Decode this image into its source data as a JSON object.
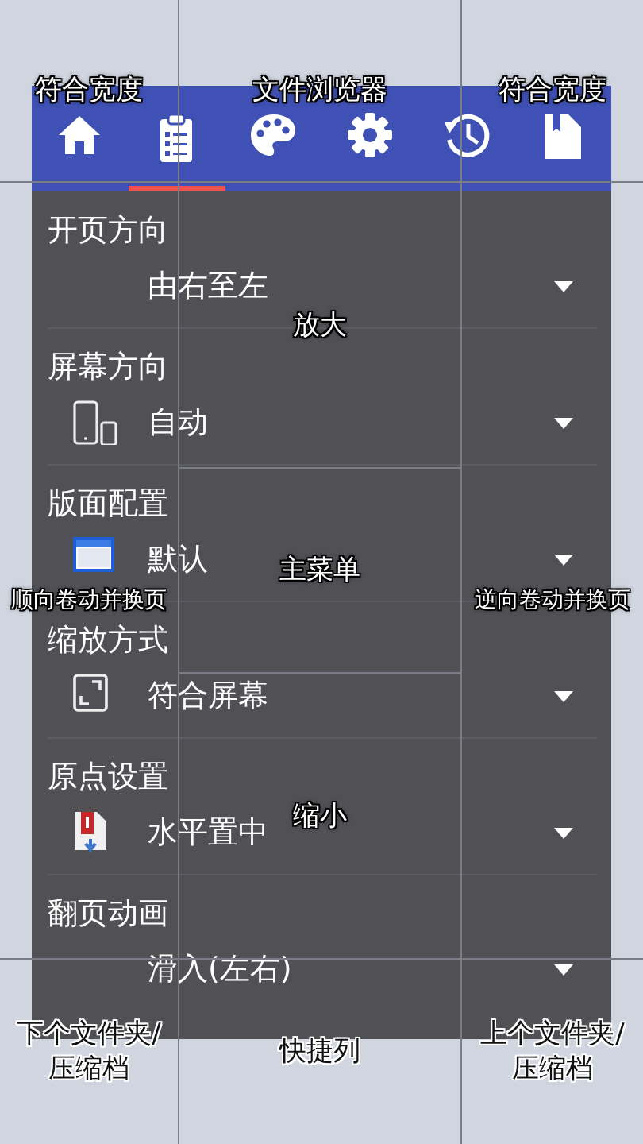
{
  "tap_zones": [
    {
      "label": "符合宽度"
    },
    {
      "label": "文件浏览器"
    },
    {
      "label": "符合宽度"
    },
    {
      "label": "顺向卷动并换页"
    },
    {
      "label": "放大"
    },
    {
      "label": "主菜单"
    },
    {
      "label": "缩小"
    },
    {
      "label": "逆向卷动并换页"
    },
    {
      "label": "下个文件夹/压缩档"
    },
    {
      "label": "快捷列"
    },
    {
      "label": "上个文件夹/压缩档"
    }
  ],
  "tabs": [
    {
      "selected": false
    },
    {
      "selected": true
    },
    {
      "selected": false
    },
    {
      "selected": false
    },
    {
      "selected": false
    },
    {
      "selected": false
    }
  ],
  "settings": [
    {
      "label": "开页方向",
      "value": "由右至左"
    },
    {
      "label": "屏幕方向",
      "value": "自动"
    },
    {
      "label": "版面配置",
      "value": "默认"
    },
    {
      "label": "缩放方式",
      "value": "符合屏幕"
    },
    {
      "label": "原点设置",
      "value": "水平置中"
    },
    {
      "label": "翻页动画",
      "value": "滑入(左右)"
    }
  ]
}
